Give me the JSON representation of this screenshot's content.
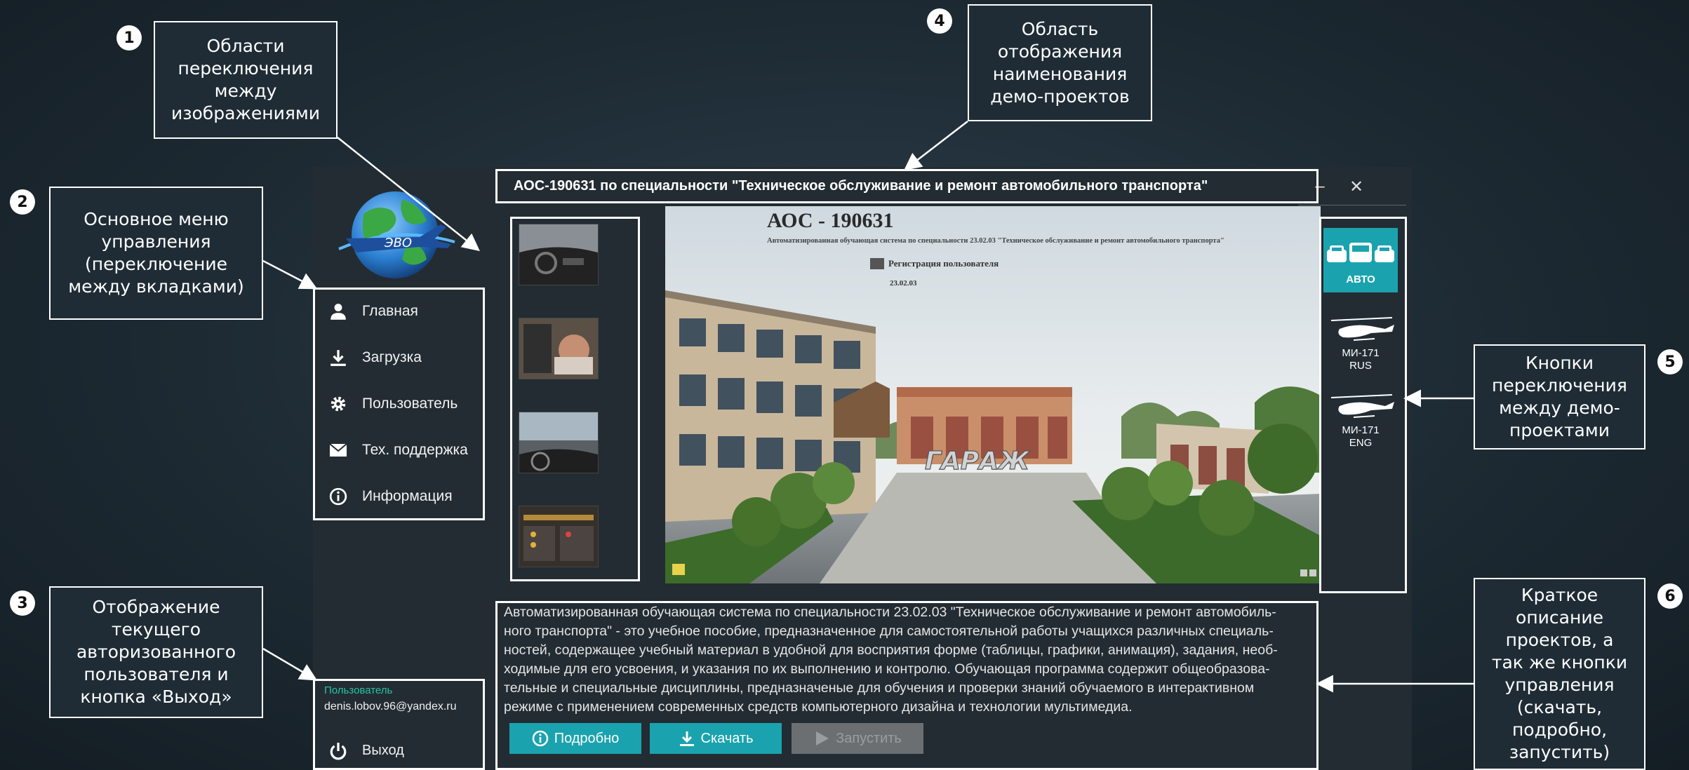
{
  "callouts": [
    {
      "num": "1",
      "text": "Области\nпереключения\nмежду\nизображениями"
    },
    {
      "num": "2",
      "text": "Основное меню\nуправления\n(переключение\nмежду вкладками)"
    },
    {
      "num": "3",
      "text": "Отображение\nтекущего\nавторизованного\nпользователя и\nкнопка «Выход»"
    },
    {
      "num": "4",
      "text": "Область\nотображения\nнаименования\nдемо-проектов"
    },
    {
      "num": "5",
      "text": "Кнопки\nпереключения\nмежду демо-\nпроектами"
    },
    {
      "num": "6",
      "text": "Краткое\nописание\nпроектов, а\nтак же кнопки\nуправления\n(скачать,\nподробно,\nзапустить)"
    }
  ],
  "window": {
    "title": "АОС-190631 по специальности \"Техническое обслуживание и ремонт автомобильного транспорта\"",
    "minimize": "–",
    "close": "✕"
  },
  "menu": {
    "items": [
      {
        "label": "Главная",
        "icon": "user-icon"
      },
      {
        "label": "Загрузка",
        "icon": "download-icon"
      },
      {
        "label": "Пользователь",
        "icon": "gear-icon"
      },
      {
        "label": "Тех. поддержка",
        "icon": "mail-icon"
      },
      {
        "label": "Информация",
        "icon": "info-icon"
      }
    ]
  },
  "user": {
    "label": "Пользователь",
    "email": "denis.lobov.96@yandex.ru",
    "logout": "Выход"
  },
  "preview": {
    "heading": "АОС - 190631",
    "subheading": "Автоматизированная обучающая система по специальности 23.02.03 \"Техническое обслуживание и ремонт автомобильного транспорта\"",
    "reg": "Регистрация пользователя",
    "date": "23.02.03",
    "garage": "ГАРАЖ"
  },
  "projects": [
    {
      "label": "АВТО",
      "active": true
    },
    {
      "label": "МИ-171\nRUS",
      "active": false
    },
    {
      "label": "МИ-171\nENG",
      "active": false
    }
  ],
  "description": "Автоматизированная обучающая система по специальности 23.02.03 \"Техническое обслуживание и ремонт автомобиль-ного транспорта\" - это учебное пособие, предназначенное для самостоятельной работы учащихся различных специаль-ностей, содержащее учебный материал в удобной для восприятия форме (таблицы, графики, анимация), задания, необ-ходимые для его усвоения, и указания по их выполнению и контролю. Обучающая программа содержит общеобразова-тельные и специальные дисциплины, предназначеные для обучения и проверки знаний обучаемого в интерактивном режиме с применением современных средств компьютерного дизайна и технологии мультимедиа.",
  "description_lines": [
    "Автоматизированная обучающая система по специальности 23.02.03 \"Техническое обслуживание и ремонт автомобиль-",
    "ного транспорта\" - это учебное пособие, предназначенное для самостоятельной работы учащихся различных специаль-",
    "ностей, содержащее учебный материал в удобной для восприятия форме (таблицы, графики, анимация), задания, необ-",
    "ходимые для его усвоения, и указания по их выполнению и контролю. Обучающая программа содержит общеобразова-",
    "тельные и специальные дисциплины, предназначеные для обучения и проверки знаний обучаемого в интерактивном",
    "режиме с применением современных средств компьютерного дизайна и технологии мультимедиа."
  ],
  "buttons": {
    "details": "Подробно",
    "download": "Скачать",
    "launch": "Запустить"
  },
  "colors": {
    "accent": "#1aa3ae",
    "disabled": "#6c6f72",
    "user_label": "#25c3a6",
    "window_bg": "#232c33"
  }
}
